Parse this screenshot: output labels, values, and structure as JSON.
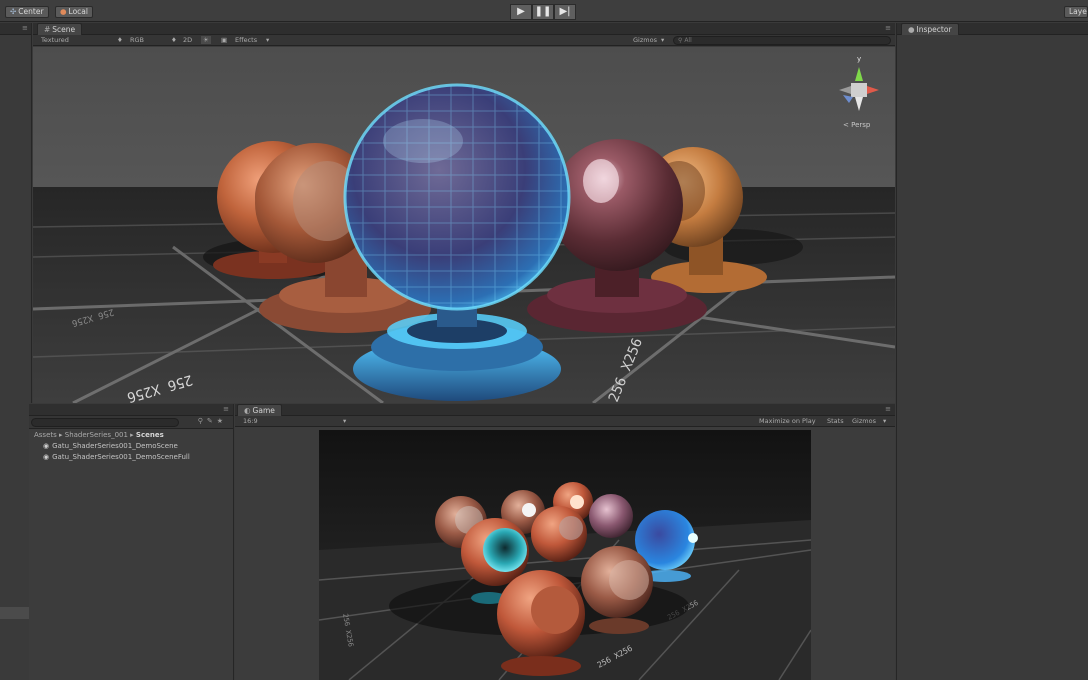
{
  "topbar": {
    "pivot_label": "Center",
    "space_label": "Local",
    "layers_label": "Layer",
    "play_icon": "play-icon",
    "pause_icon": "pause-icon",
    "step_icon": "step-icon"
  },
  "scene": {
    "tab_label": "Scene",
    "shading_mode": "Textured",
    "render_mode": "RGB",
    "mode_2d": "2D",
    "effects_label": "Effects",
    "gizmos_label": "Gizmos",
    "search_placeholder": "All",
    "gizmo_axis_label": "y",
    "persp_label": "Persp",
    "floor_text": "256 X256"
  },
  "inspector": {
    "tab_label": "Inspector"
  },
  "project": {
    "breadcrumb": [
      "Assets",
      "ShaderSeries_001",
      "Scenes"
    ],
    "files": [
      "Gatu_ShaderSeries001_DemoScene",
      "Gatu_ShaderSeries001_DemoSceneFull"
    ]
  },
  "game": {
    "tab_label": "Game",
    "aspect_label": "16:9",
    "maximize_label": "Maximize on Play",
    "stats_label": "Stats",
    "gizmos_label": "Gizmos",
    "floor_text": "256 X256"
  },
  "colors": {
    "panel_bg": "#3c3c3c",
    "header_bg": "#2e2e2e",
    "glass_blue": "#3fb6ff",
    "copper": "#c45a36"
  }
}
